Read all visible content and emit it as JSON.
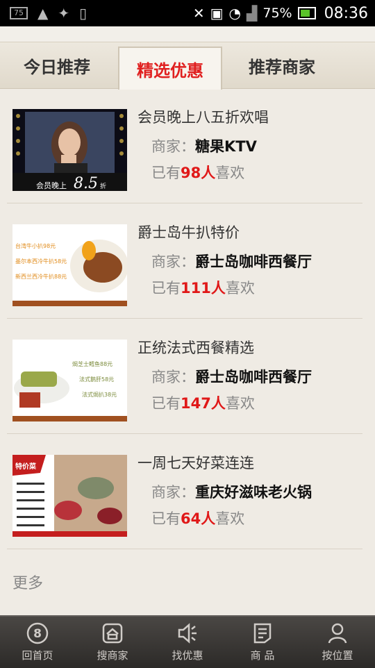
{
  "status": {
    "box": "75",
    "battery": "75%",
    "time": "08:36"
  },
  "tabs": [
    {
      "label": "今日推荐",
      "active": false
    },
    {
      "label": "精选优惠",
      "active": true
    },
    {
      "label": "推荐商家",
      "active": false
    }
  ],
  "items": [
    {
      "title": "会员晚上八五折欢唱",
      "merchant_prefix": "商家：",
      "merchant": "糖果KTV",
      "likes_prefix": "已有",
      "likes_count": "98人",
      "likes_suffix": "喜欢",
      "thumb_text": "会员晚上8.5折"
    },
    {
      "title": "爵士岛牛扒特价",
      "merchant_prefix": "商家：",
      "merchant": "爵士岛咖啡西餐厅",
      "likes_prefix": "已有",
      "likes_count": "111人",
      "likes_suffix": "喜欢",
      "thumb_lines": [
        "台湾牛小扒98元",
        "墨尔本西冷牛扒58元",
        "新西兰西冷牛扒88元"
      ]
    },
    {
      "title": "正统法式西餐精选",
      "merchant_prefix": "商家：",
      "merchant": "爵士岛咖啡西餐厅",
      "likes_prefix": "已有",
      "likes_count": "147人",
      "likes_suffix": "喜欢",
      "thumb_lines": [
        "焗芝士鳕鱼88元",
        "法式鹅肝58元",
        "法式焗扒38元"
      ]
    },
    {
      "title": "一周七天好菜连连",
      "merchant_prefix": "商家：",
      "merchant": "重庆好滋味老火锅",
      "likes_prefix": "已有",
      "likes_count": "64人",
      "likes_suffix": "喜欢",
      "thumb_badge": "特价菜"
    }
  ],
  "more_label": "更多",
  "bottom_nav": [
    {
      "label": "回首页",
      "icon": "home-8-icon"
    },
    {
      "label": "搜商家",
      "icon": "shop-icon"
    },
    {
      "label": "找优惠",
      "icon": "speaker-icon"
    },
    {
      "label": "商 品",
      "icon": "document-icon"
    },
    {
      "label": "按位置",
      "icon": "person-icon"
    }
  ]
}
